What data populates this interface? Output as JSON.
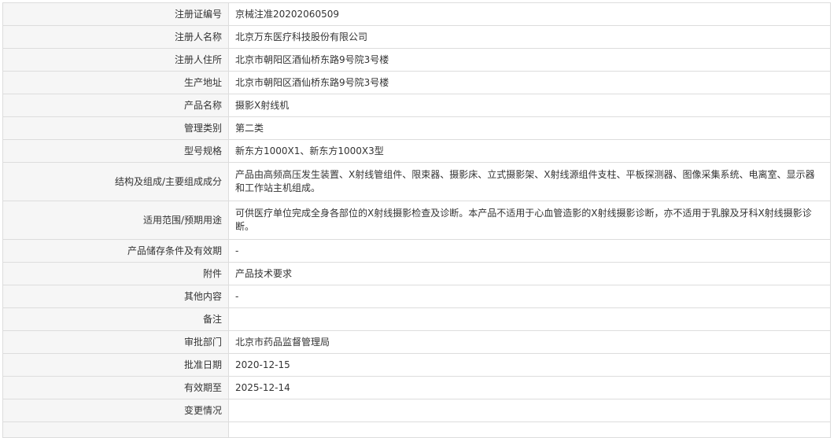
{
  "rows": [
    {
      "label": "注册证编号",
      "value": "京械注准20202060509"
    },
    {
      "label": "注册人名称",
      "value": "北京万东医疗科技股份有限公司"
    },
    {
      "label": "注册人住所",
      "value": "北京市朝阳区酒仙桥东路9号院3号楼"
    },
    {
      "label": "生产地址",
      "value": "北京市朝阳区酒仙桥东路9号院3号楼"
    },
    {
      "label": "产品名称",
      "value": "摄影X射线机"
    },
    {
      "label": "管理类别",
      "value": "第二类"
    },
    {
      "label": "型号规格",
      "value": "新东方1000X1、新东方1000X3型"
    },
    {
      "label": "结构及组成/主要组成成分",
      "value": "产品由高频高压发生装置、X射线管组件、限束器、摄影床、立式摄影架、X射线源组件支柱、平板探测器、图像采集系统、电离室、显示器和工作站主机组成。"
    },
    {
      "label": "适用范围/预期用途",
      "value": "可供医疗单位完成全身各部位的X射线摄影检查及诊断。本产品不适用于心血管造影的X射线摄影诊断，亦不适用于乳腺及牙科X射线摄影诊断。"
    },
    {
      "label": "产品储存条件及有效期",
      "value": "-"
    },
    {
      "label": "附件",
      "value": "产品技术要求"
    },
    {
      "label": "其他内容",
      "value": "-"
    },
    {
      "label": "备注",
      "value": ""
    },
    {
      "label": "审批部门",
      "value": "北京市药品监督管理局"
    },
    {
      "label": "批准日期",
      "value": "2020-12-15"
    },
    {
      "label": "有效期至",
      "value": "2025-12-14"
    },
    {
      "label": "变更情况",
      "value": ""
    }
  ]
}
